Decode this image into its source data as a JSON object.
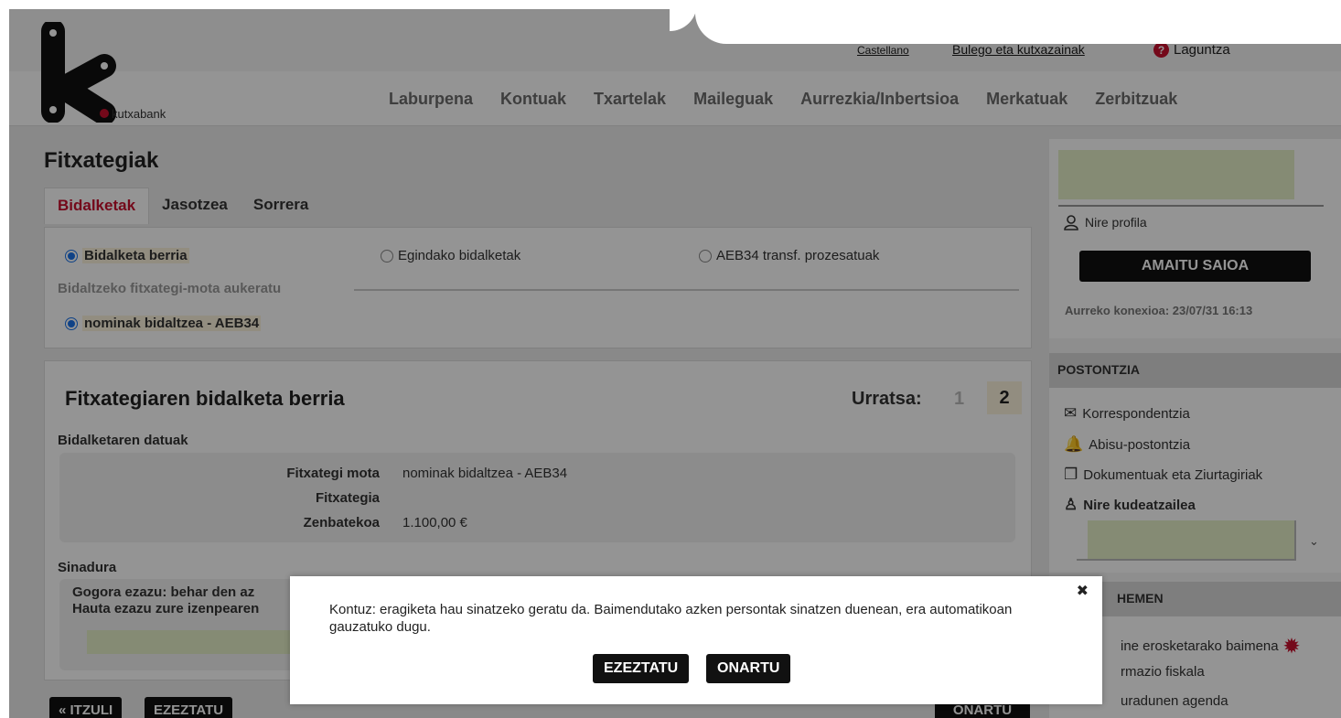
{
  "brand": {
    "name": "kutxabank"
  },
  "toplinks": {
    "language": "Castellano",
    "offices": "Bulego eta kutxazainak",
    "help": "Laguntza"
  },
  "nav": [
    "Laburpena",
    "Kontuak",
    "Txartelak",
    "Maileguak",
    "Aurrezkia/Inbertsioa",
    "Merkatuak",
    "Zerbitzuak"
  ],
  "page": {
    "title": "Fitxategiak"
  },
  "tabs": [
    "Bidalketak",
    "Jasotzea",
    "Sorrera"
  ],
  "send_options": {
    "new": "Bidalketa berria",
    "done": "Egindako bidalketak",
    "aeb34": "AEB34 transf. prozesatuak",
    "choose_label": "Bidaltzeko fitxategi-mota aukeratu",
    "type_option": "nominak bidaltzea - AEB34"
  },
  "new_send": {
    "title": "Fitxategiaren bidalketa berria",
    "step_label": "Urratsa:",
    "step_1": "1",
    "step_2": "2",
    "data_title": "Bidalketaren datuak",
    "fields": {
      "type_label": "Fitxategi mota",
      "type_value": "nominak bidaltzea - AEB34",
      "file_label": "Fitxategia",
      "amount_label": "Zenbatekoa",
      "amount_value": "1.100,00 €"
    },
    "signature_title": "Sinadura",
    "signature_line1": "Gogora ezazu: behar den az",
    "signature_line2": "Hauta ezazu zure izenpearen"
  },
  "bottom_buttons": {
    "back": "« ITZULI",
    "cancel": "EZEZTATU",
    "accept": "ONARTU"
  },
  "sidebar": {
    "profile": "Nire profila",
    "logout": "AMAITU SAIOA",
    "last_connection": "Aurreko konexioa: 23/07/31 16:13",
    "mailbox_head": "POSTONTZIA",
    "mailbox_items": [
      "Korrespondentzia",
      "Abisu-postontzia",
      "Dokumentuak eta Ziurtagiriak",
      "Nire kudeatzailea"
    ],
    "here_head": "HEMEN",
    "here_items": [
      "ine erosketarako baimena",
      "rmazio fiskala",
      "uradunen agenda"
    ]
  },
  "modal": {
    "message": "Kontuz: eragiketa hau sinatzeko geratu da. Baimendutako azken persontak sinatzen duenean, era automatikoan gauzatuko dugu.",
    "cancel": "EZEZTATU",
    "accept": "ONARTU",
    "close": "✖"
  },
  "colors": {
    "accent_red": "#c8102e",
    "radio_blue": "#1a73e8",
    "redact": "#e6f0c8"
  }
}
